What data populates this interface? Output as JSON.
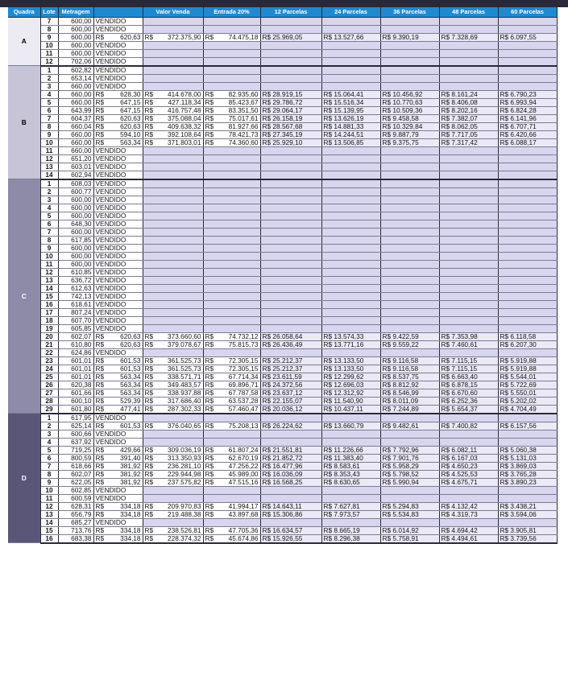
{
  "headers": [
    "Quadra",
    "Lote",
    "Metragem",
    "",
    "Valor Venda",
    "Entrada 20%",
    "12 Parcelas",
    "24 Parcelas",
    "36 Parcelas",
    "48 Parcelas",
    "60 Parcelas"
  ],
  "currency": "R$",
  "status_sold": "VENDIDO",
  "quadras": [
    {
      "name": "A",
      "rows": [
        {
          "lote": "7",
          "met": "600,00",
          "sold": true
        },
        {
          "lote": "8",
          "met": "600,00",
          "sold": true
        },
        {
          "lote": "9",
          "met": "600,00",
          "m2": "620,63",
          "valor": "372.375,90",
          "entrada": "74.475,18",
          "p12": "R$ 25.969,05",
          "p24": "R$ 13.527,66",
          "p36": "R$ 9.390,19",
          "p48": "R$ 7.328,69",
          "p60": "R$ 6.097,55"
        },
        {
          "lote": "10",
          "met": "600,00",
          "sold": true
        },
        {
          "lote": "11",
          "met": "600,00",
          "sold": true
        },
        {
          "lote": "12",
          "met": "702,06",
          "sold": true
        }
      ]
    },
    {
      "name": "B",
      "rows": [
        {
          "lote": "1",
          "met": "602,82",
          "sold": true
        },
        {
          "lote": "2",
          "met": "653,14",
          "sold": true
        },
        {
          "lote": "3",
          "met": "660,00",
          "sold": true
        },
        {
          "lote": "4",
          "met": "660,00",
          "m2": "628,30",
          "valor": "414.678,00",
          "entrada": "82.935,60",
          "p12": "R$ 28.919,15",
          "p24": "R$ 15.064,41",
          "p36": "R$ 10.456,92",
          "p48": "R$ 8.161,24",
          "p60": "R$ 6.790,23"
        },
        {
          "lote": "5",
          "met": "660,00",
          "m2": "647,15",
          "valor": "427.118,34",
          "entrada": "85.423,67",
          "p12": "R$ 29.786,72",
          "p24": "R$ 15.516,34",
          "p36": "R$ 10.770,63",
          "p48": "R$ 8.406,08",
          "p60": "R$ 6.993,94"
        },
        {
          "lote": "6",
          "met": "643,99",
          "m2": "647,15",
          "valor": "416.757,48",
          "entrada": "83.351,50",
          "p12": "R$ 29.064,17",
          "p24": "R$ 15.139,95",
          "p36": "R$ 10.509,36",
          "p48": "R$ 8.202,16",
          "p60": "R$ 6.824,28"
        },
        {
          "lote": "7",
          "met": "604,37",
          "m2": "620,63",
          "valor": "375.088,04",
          "entrada": "75.017,61",
          "p12": "R$ 26.158,19",
          "p24": "R$ 13.626,19",
          "p36": "R$ 9.458,58",
          "p48": "R$ 7.382,07",
          "p60": "R$ 6.141,96"
        },
        {
          "lote": "8",
          "met": "660,04",
          "m2": "620,63",
          "valor": "409.638,32",
          "entrada": "81.927,66",
          "p12": "R$ 28.567,68",
          "p24": "R$ 14.881,33",
          "p36": "R$ 10.329,84",
          "p48": "R$ 8.062,05",
          "p60": "R$ 6.707,71"
        },
        {
          "lote": "9",
          "met": "660,00",
          "m2": "594,10",
          "valor": "392.108,64",
          "entrada": "78.421,73",
          "p12": "R$ 27.345,19",
          "p24": "R$ 14.244,51",
          "p36": "R$ 9.887,79",
          "p48": "R$ 7.717,05",
          "p60": "R$ 6.420,66"
        },
        {
          "lote": "10",
          "met": "660,00",
          "m2": "563,34",
          "valor": "371.803,01",
          "entrada": "74.360,60",
          "p12": "R$ 25.929,10",
          "p24": "R$ 13.506,85",
          "p36": "R$ 9.375,75",
          "p48": "R$ 7.317,42",
          "p60": "R$ 6.088,17"
        },
        {
          "lote": "11",
          "met": "660,00",
          "sold": true
        },
        {
          "lote": "12",
          "met": "651,20",
          "sold": true
        },
        {
          "lote": "13",
          "met": "603,01",
          "sold": true
        },
        {
          "lote": "14",
          "met": "602,94",
          "sold": true
        }
      ]
    },
    {
      "name": "C",
      "rows": [
        {
          "lote": "1",
          "met": "608,03",
          "sold": true
        },
        {
          "lote": "2",
          "met": "600,77",
          "sold": true
        },
        {
          "lote": "3",
          "met": "600,00",
          "sold": true
        },
        {
          "lote": "4",
          "met": "600,00",
          "sold": true
        },
        {
          "lote": "5",
          "met": "600,00",
          "sold": true
        },
        {
          "lote": "6",
          "met": "648,30",
          "sold": true
        },
        {
          "lote": "7",
          "met": "600,00",
          "sold": true
        },
        {
          "lote": "8",
          "met": "617,85",
          "sold": true
        },
        {
          "lote": "9",
          "met": "600,00",
          "sold": true
        },
        {
          "lote": "10",
          "met": "600,00",
          "sold": true
        },
        {
          "lote": "11",
          "met": "600,00",
          "sold": true
        },
        {
          "lote": "12",
          "met": "610,85",
          "sold": true
        },
        {
          "lote": "13",
          "met": "636,72",
          "sold": true
        },
        {
          "lote": "14",
          "met": "612,63",
          "sold": true
        },
        {
          "lote": "15",
          "met": "742,13",
          "sold": true
        },
        {
          "lote": "16",
          "met": "618,61",
          "sold": true
        },
        {
          "lote": "17",
          "met": "807,24",
          "sold": true
        },
        {
          "lote": "18",
          "met": "607,70",
          "sold": true
        },
        {
          "lote": "19",
          "met": "605,85",
          "sold": true
        },
        {
          "lote": "20",
          "met": "602,07",
          "m2": "620,63",
          "valor": "373.660,60",
          "entrada": "74.732,12",
          "p12": "R$ 26.058,64",
          "p24": "R$ 13.574,33",
          "p36": "R$ 9.422,59",
          "p48": "R$ 7.353,98",
          "p60": "R$ 6.118,58"
        },
        {
          "lote": "21",
          "met": "610,80",
          "m2": "620,63",
          "valor": "379.078,67",
          "entrada": "75.815,73",
          "p12": "R$ 26.436,49",
          "p24": "R$ 13.771,16",
          "p36": "R$ 9.559,22",
          "p48": "R$ 7.460,61",
          "p60": "R$ 6.207,30"
        },
        {
          "lote": "22",
          "met": "624,86",
          "sold": true
        },
        {
          "lote": "23",
          "met": "601,01",
          "m2": "601,53",
          "valor": "361.525,73",
          "entrada": "72.305,15",
          "p12": "R$ 25.212,37",
          "p24": "R$ 13.133,50",
          "p36": "R$ 9.116,58",
          "p48": "R$ 7.115,15",
          "p60": "R$ 5.919,88"
        },
        {
          "lote": "24",
          "met": "601,01",
          "m2": "601,53",
          "valor": "361.525,73",
          "entrada": "72.305,15",
          "p12": "R$ 25.212,37",
          "p24": "R$ 13.133,50",
          "p36": "R$ 9.116,58",
          "p48": "R$ 7.115,15",
          "p60": "R$ 5.919,88"
        },
        {
          "lote": "25",
          "met": "601,01",
          "m2": "563,34",
          "valor": "338.571,71",
          "entrada": "67.714,34",
          "p12": "R$ 23.611,59",
          "p24": "R$ 12.299,62",
          "p36": "R$ 8.537,75",
          "p48": "R$ 6.663,40",
          "p60": "R$ 5.544,01"
        },
        {
          "lote": "26",
          "met": "620,38",
          "m2": "563,34",
          "valor": "349.483,57",
          "entrada": "69.896,71",
          "p12": "R$ 24.372,56",
          "p24": "R$ 12.696,03",
          "p36": "R$ 8.812,92",
          "p48": "R$ 6.878,15",
          "p60": "R$ 5.722,69"
        },
        {
          "lote": "27",
          "met": "601,66",
          "m2": "563,34",
          "valor": "338.937,88",
          "entrada": "67.787,58",
          "p12": "R$ 23.637,12",
          "p24": "R$ 12.312,92",
          "p36": "R$ 8.546,99",
          "p48": "R$ 6.670,60",
          "p60": "R$ 5.550,01"
        },
        {
          "lote": "28",
          "met": "600,10",
          "m2": "529,39",
          "valor": "317.686,40",
          "entrada": "63.537,28",
          "p12": "R$ 22.155,07",
          "p24": "R$ 11.540,90",
          "p36": "R$ 8.011,09",
          "p48": "R$ 6.252,36",
          "p60": "R$ 5.202,02"
        },
        {
          "lote": "29",
          "met": "601,80",
          "m2": "477,41",
          "valor": "287.302,33",
          "entrada": "57.460,47",
          "p12": "R$ 20.036,12",
          "p24": "R$ 10.437,11",
          "p36": "R$ 7.244,89",
          "p48": "R$ 5.654,37",
          "p60": "R$ 4.704,49"
        }
      ]
    },
    {
      "name": "D",
      "rows": [
        {
          "lote": "1",
          "met": "617,95",
          "sold": true
        },
        {
          "lote": "2",
          "met": "625,14",
          "m2": "601,53",
          "valor": "376.040,65",
          "entrada": "75.208,13",
          "p12": "R$ 26.224,62",
          "p24": "R$ 13.660,79",
          "p36": "R$ 9.482,61",
          "p48": "R$ 7.400,82",
          "p60": "R$ 6.157,56"
        },
        {
          "lote": "3",
          "met": "600,66",
          "sold": true
        },
        {
          "lote": "4",
          "met": "637,92",
          "sold": true
        },
        {
          "lote": "5",
          "met": "719,25",
          "m2": "429,66",
          "valor": "309.036,19",
          "entrada": "61.807,24",
          "p12": "R$ 21.551,81",
          "p24": "R$ 11.226,66",
          "p36": "R$ 7.792,96",
          "p48": "R$ 6.082,11",
          "p60": "R$ 5.060,38"
        },
        {
          "lote": "6",
          "met": "800,59",
          "m2": "391,40",
          "valor": "313.350,93",
          "entrada": "62.670,19",
          "p12": "R$ 21.852,72",
          "p24": "R$ 11.383,40",
          "p36": "R$ 7.901,76",
          "p48": "R$ 6.167,03",
          "p60": "R$ 5.131,03"
        },
        {
          "lote": "7",
          "met": "618,66",
          "m2": "381,92",
          "valor": "236.281,10",
          "entrada": "47.256,22",
          "p12": "R$ 16.477,96",
          "p24": "R$ 8.583,61",
          "p36": "R$ 5.958,29",
          "p48": "R$ 4.650,23",
          "p60": "R$ 3.869,03"
        },
        {
          "lote": "8",
          "met": "602,07",
          "m2": "381,92",
          "valor": "229.944,98",
          "entrada": "45.989,00",
          "p12": "R$ 16.036,09",
          "p24": "R$ 8.353,43",
          "p36": "R$ 5.798,52",
          "p48": "R$ 4.525,53",
          "p60": "R$ 3.765,28"
        },
        {
          "lote": "9",
          "met": "622,05",
          "m2": "381,92",
          "valor": "237.575,82",
          "entrada": "47.515,16",
          "p12": "R$ 16.568,25",
          "p24": "R$ 8.630,65",
          "p36": "R$ 5.990,94",
          "p48": "R$ 4.675,71",
          "p60": "R$ 3.890,23"
        },
        {
          "lote": "10",
          "met": "602,85",
          "sold": true
        },
        {
          "lote": "11",
          "met": "600,59",
          "sold": true
        },
        {
          "lote": "12",
          "met": "628,31",
          "m2": "334,18",
          "valor": "209.970,83",
          "entrada": "41.994,17",
          "p12": "R$ 14.643,11",
          "p24": "R$ 7.627,81",
          "p36": "R$ 5.294,83",
          "p48": "R$ 4.132,42",
          "p60": "R$ 3.438,21"
        },
        {
          "lote": "13",
          "met": "656,79",
          "m2": "334,18",
          "valor": "219.488,38",
          "entrada": "43.897,68",
          "p12": "R$ 15.306,86",
          "p24": "R$ 7.973,57",
          "p36": "R$ 5.534,83",
          "p48": "R$ 4.319,73",
          "p60": "R$ 3.594,06"
        },
        {
          "lote": "14",
          "met": "685,27",
          "sold": true
        },
        {
          "lote": "15",
          "met": "713,76",
          "m2": "334,18",
          "valor": "238.526,81",
          "entrada": "47.705,36",
          "p12": "R$ 16.634,57",
          "p24": "R$ 8.665,19",
          "p36": "R$ 6.014,92",
          "p48": "R$ 4.694,42",
          "p60": "R$ 3.905,81"
        },
        {
          "lote": "16",
          "met": "683,38",
          "m2": "334,18",
          "valor": "228.374,32",
          "entrada": "45.674,86",
          "p12": "R$ 15.926,55",
          "p24": "R$ 8.296,38",
          "p36": "R$ 5.758,91",
          "p48": "R$ 4.494,61",
          "p60": "R$ 3.739,56"
        }
      ]
    }
  ]
}
